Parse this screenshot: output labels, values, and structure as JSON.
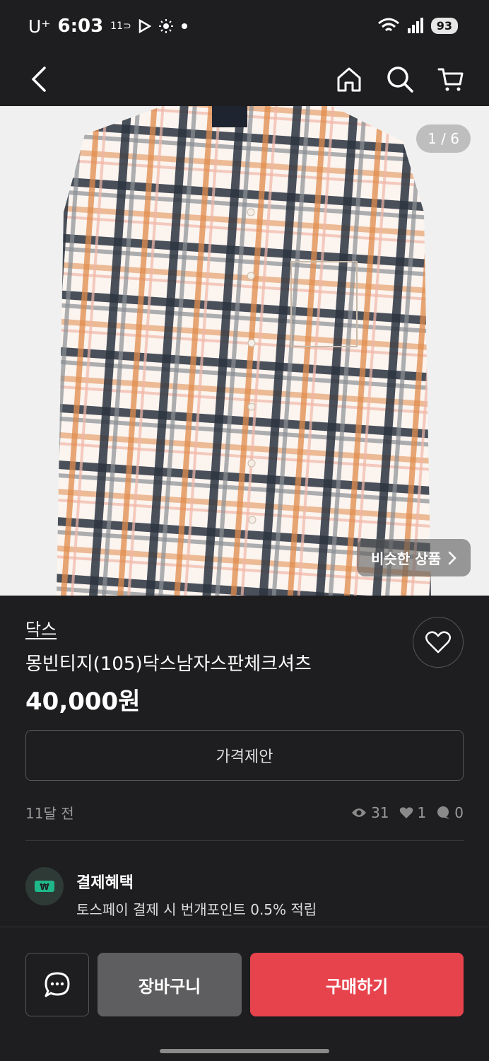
{
  "status_bar": {
    "carrier": "U⁺",
    "time": "6:03",
    "indicator": "11⊃",
    "battery": "93"
  },
  "nav": {
    "back_icon": "chevron-left-icon",
    "home_icon": "home-icon",
    "search_icon": "search-icon",
    "cart_icon": "cart-icon"
  },
  "gallery": {
    "counter": "1 / 6",
    "similar_label": "비슷한 상품"
  },
  "product": {
    "brand": "닥스",
    "title": "몽빈티지(105)닥스남자스판체크셔츠",
    "price": "40,000원",
    "offer_label": "가격제안",
    "posted": "11달 전",
    "views": "31",
    "likes": "1",
    "chats": "0"
  },
  "benefit": {
    "title": "결제혜택",
    "description": "토스페이 결제 시 번개포인트 0.5% 적립"
  },
  "actions": {
    "cart_label": "장바구니",
    "buy_label": "구매하기"
  },
  "colors": {
    "background": "#1e1e20",
    "buy": "#e6434d",
    "cart": "#5e5e60"
  }
}
